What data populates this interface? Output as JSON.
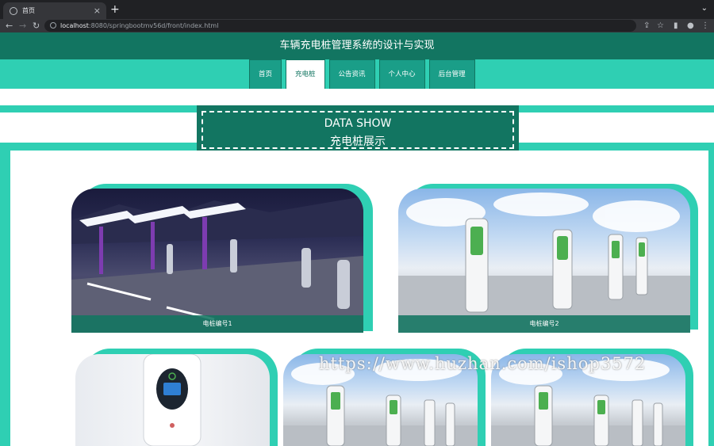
{
  "browser": {
    "tab_title": "首页",
    "url_host": "localhost",
    "url_rest": ":8080/springbootmv56d/front/index.html"
  },
  "header": {
    "title": "车辆充电桩管理系统的设计与实现"
  },
  "nav": {
    "items": [
      {
        "label": "首页",
        "active": false
      },
      {
        "label": "充电桩",
        "active": true
      },
      {
        "label": "公告资讯",
        "active": false
      },
      {
        "label": "个人中心",
        "active": false
      },
      {
        "label": "后台管理",
        "active": false
      }
    ]
  },
  "section": {
    "title_en": "DATA SHOW",
    "title_cn": "充电桩展示"
  },
  "cards": [
    {
      "caption": "电桩编号1"
    },
    {
      "caption": "电桩编号2"
    }
  ],
  "watermark": "https://www.huzhan.com/ishop3572",
  "colors": {
    "dark_teal": "#127561",
    "teal": "#2fcfb3",
    "nav_item": "#1a9e88"
  }
}
